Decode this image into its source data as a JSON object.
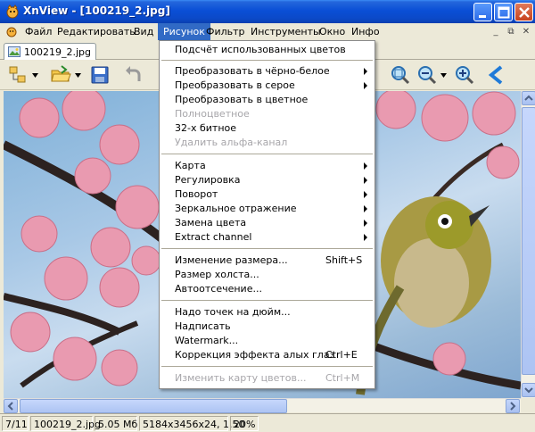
{
  "window": {
    "title": "XnView - [100219_2.jpg]"
  },
  "menubar": {
    "items": [
      "Файл",
      "Редактировать",
      "Вид",
      "Рисунок",
      "Фильтр",
      "Инструменты",
      "Окно",
      "Инфо"
    ],
    "active": "Рисунок"
  },
  "tab": {
    "label": "100219_2.jpg"
  },
  "dropdown": {
    "items": [
      {
        "label": "Подсчёт использованных цветов",
        "shortcut": "",
        "submenu": false,
        "enabled": true
      },
      {
        "label": "Преобразовать в чёрно-белое",
        "shortcut": "",
        "submenu": true,
        "enabled": true
      },
      {
        "label": "Преобразовать в серое",
        "shortcut": "",
        "submenu": true,
        "enabled": true
      },
      {
        "label": "Преобразовать в цветное",
        "shortcut": "",
        "submenu": false,
        "enabled": true
      },
      {
        "label": "Полноцветное",
        "shortcut": "",
        "submenu": false,
        "enabled": false
      },
      {
        "label": "32-х битное",
        "shortcut": "",
        "submenu": false,
        "enabled": true
      },
      {
        "label": "Удалить альфа-канал",
        "shortcut": "",
        "submenu": false,
        "enabled": false
      },
      {
        "label": "Карта",
        "shortcut": "",
        "submenu": true,
        "enabled": true
      },
      {
        "label": "Регулировка",
        "shortcut": "",
        "submenu": true,
        "enabled": true
      },
      {
        "label": "Поворот",
        "shortcut": "",
        "submenu": true,
        "enabled": true
      },
      {
        "label": "Зеркальное отражение",
        "shortcut": "",
        "submenu": true,
        "enabled": true
      },
      {
        "label": "Замена цвета",
        "shortcut": "",
        "submenu": true,
        "enabled": true
      },
      {
        "label": "Extract channel",
        "shortcut": "",
        "submenu": true,
        "enabled": true
      },
      {
        "label": "Изменение размера...",
        "shortcut": "Shift+S",
        "submenu": false,
        "enabled": true
      },
      {
        "label": "Размер холста...",
        "shortcut": "",
        "submenu": false,
        "enabled": true
      },
      {
        "label": "Автоотсечение...",
        "shortcut": "",
        "submenu": false,
        "enabled": true
      },
      {
        "label": "Надо точек на дюйм...",
        "shortcut": "",
        "submenu": false,
        "enabled": true
      },
      {
        "label": "Надписать",
        "shortcut": "",
        "submenu": false,
        "enabled": true
      },
      {
        "label": "Watermark...",
        "shortcut": "",
        "submenu": false,
        "enabled": true
      },
      {
        "label": "Коррекция эффекта алых глаз",
        "shortcut": "Ctrl+E",
        "submenu": false,
        "enabled": true
      },
      {
        "label": "Изменить карту цветов...",
        "shortcut": "Ctrl+M",
        "submenu": false,
        "enabled": false
      }
    ]
  },
  "statusbar": {
    "index": "7/11",
    "filename": "100219_2.jpg",
    "filesize": "5.05 Мб",
    "dimensions": "5184x3456x24, 1.50",
    "zoom": "20%"
  },
  "colors": {
    "titlebar": "#0a4fd6",
    "menu_highlight": "#316ac5",
    "window_bg": "#ece9d8"
  }
}
